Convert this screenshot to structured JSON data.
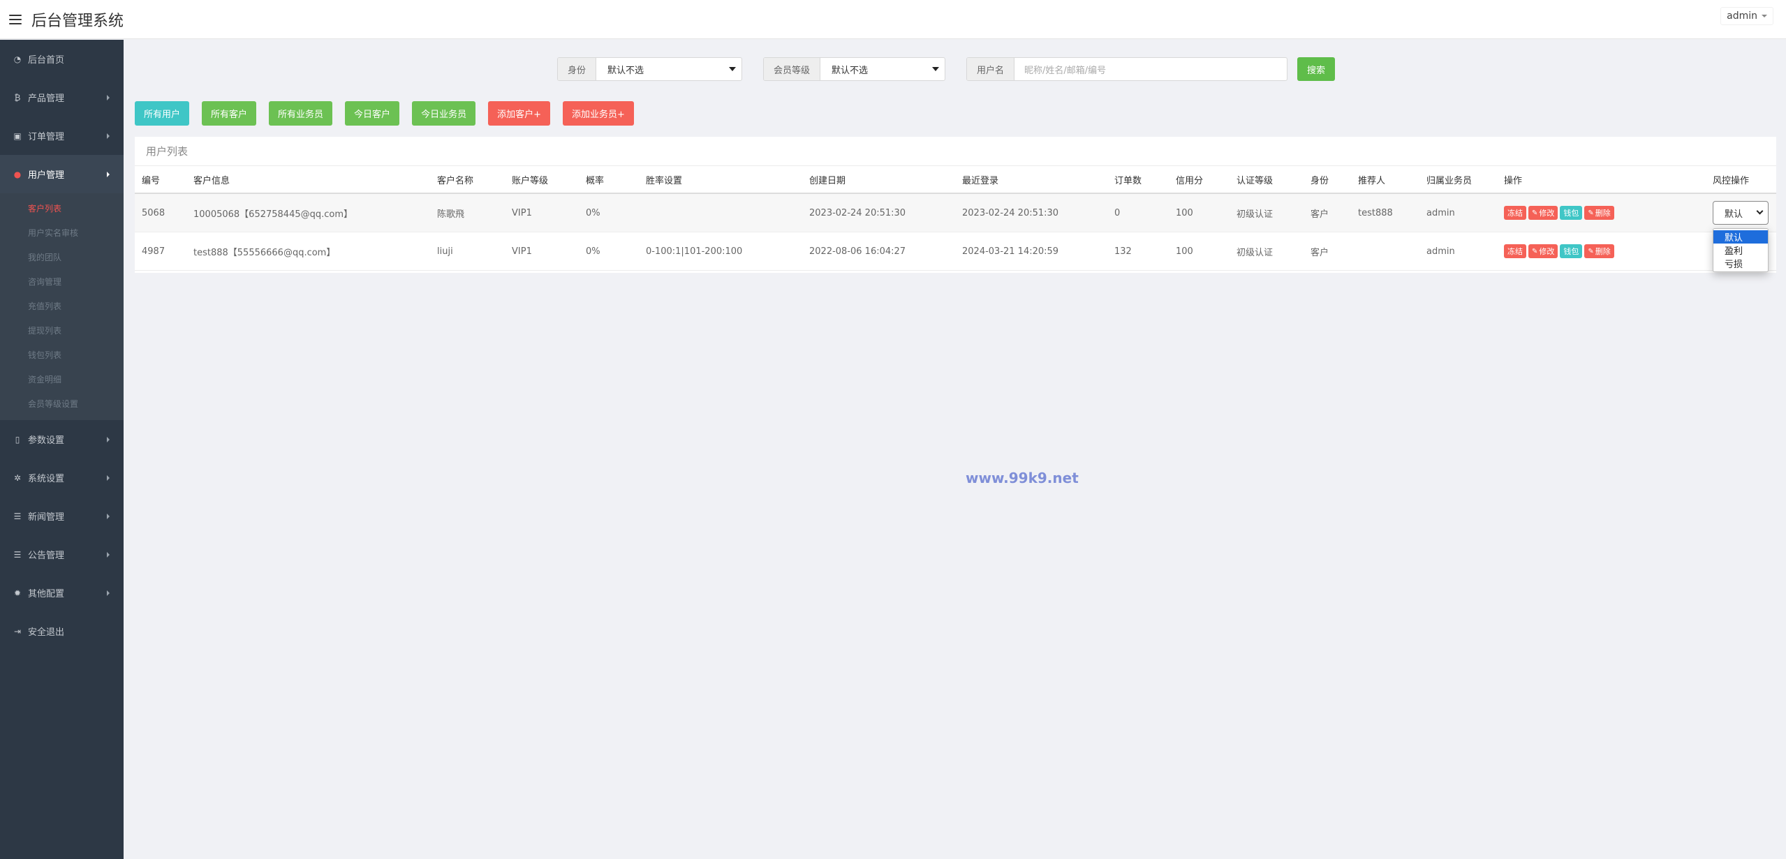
{
  "header": {
    "title": "后台管理系统",
    "user": "admin"
  },
  "sidebar": {
    "items": [
      {
        "label": "后台首页",
        "icon": "dashboard-icon",
        "glyph": "◔",
        "has_arrow": false
      },
      {
        "label": "产品管理",
        "icon": "bitcoin-icon",
        "glyph": "₿",
        "has_arrow": true
      },
      {
        "label": "订单管理",
        "icon": "order-icon",
        "glyph": "▣",
        "has_arrow": true
      },
      {
        "label": "用户管理",
        "icon": "user-icon",
        "glyph": "●",
        "has_arrow": true,
        "active": true
      },
      {
        "label": "参数设置",
        "icon": "file-icon",
        "glyph": "▯",
        "has_arrow": true
      },
      {
        "label": "系统设置",
        "icon": "cogs-icon",
        "glyph": "✲",
        "has_arrow": true
      },
      {
        "label": "新闻管理",
        "icon": "list-icon",
        "glyph": "☰",
        "has_arrow": true
      },
      {
        "label": "公告管理",
        "icon": "list-icon",
        "glyph": "☰",
        "has_arrow": true
      },
      {
        "label": "其他配置",
        "icon": "gear-icon",
        "glyph": "✹",
        "has_arrow": true
      },
      {
        "label": "安全退出",
        "icon": "sign-out-icon",
        "glyph": "⇥",
        "has_arrow": false
      }
    ],
    "submenu": [
      "客户列表",
      "用户实名审核",
      "我的团队",
      "咨询管理",
      "充值列表",
      "提现列表",
      "钱包列表",
      "资金明细",
      "会员等级设置"
    ]
  },
  "filters": {
    "identity_label": "身份",
    "identity_value": "默认不选",
    "level_label": "会员等级",
    "level_value": "默认不选",
    "username_label": "用户名",
    "username_placeholder": "昵称/姓名/邮箱/编号",
    "search_label": "搜索"
  },
  "actions": [
    {
      "label": "所有用户",
      "color": "teal"
    },
    {
      "label": "所有客户",
      "color": "green"
    },
    {
      "label": "所有业务员",
      "color": "green"
    },
    {
      "label": "今日客户",
      "color": "green"
    },
    {
      "label": "今日业务员",
      "color": "green"
    },
    {
      "label": "添加客户+",
      "color": "red"
    },
    {
      "label": "添加业务员+",
      "color": "red"
    }
  ],
  "table": {
    "title": "用户列表",
    "columns": [
      "编号",
      "客户信息",
      "客户名称",
      "账户等级",
      "概率",
      "胜率设置",
      "创建日期",
      "最近登录",
      "订单数",
      "信用分",
      "认证等级",
      "身份",
      "推荐人",
      "归属业务员",
      "操作",
      "风控操作"
    ],
    "rows": [
      {
        "id": "5068",
        "info": "10005068【652758445@qq.com】",
        "name": "陈歌飛",
        "level": "VIP1",
        "prob": "0%",
        "winrate": "",
        "created": "2023-02-24 20:51:30",
        "last_login": "2023-02-24 20:51:30",
        "orders": "0",
        "credit": "100",
        "auth": "初级认证",
        "role": "客户",
        "referrer": "test888",
        "agent": "admin"
      },
      {
        "id": "4987",
        "info": "test888【55556666@qq.com】",
        "name": "liuji",
        "level": "VIP1",
        "prob": "0%",
        "winrate": "0-100:1|101-200:100",
        "created": "2022-08-06 16:04:27",
        "last_login": "2024-03-21 14:20:59",
        "orders": "132",
        "credit": "100",
        "auth": "初级认证",
        "role": "客户",
        "referrer": "",
        "agent": "admin"
      }
    ],
    "op_buttons": {
      "freeze": "冻结",
      "edit": "修改",
      "wallet": "钱包",
      "delete": "删除"
    },
    "risk": {
      "value": "默认",
      "options": [
        "默认",
        "盈利",
        "亏损"
      ]
    }
  },
  "watermark": "www.99k9.net"
}
